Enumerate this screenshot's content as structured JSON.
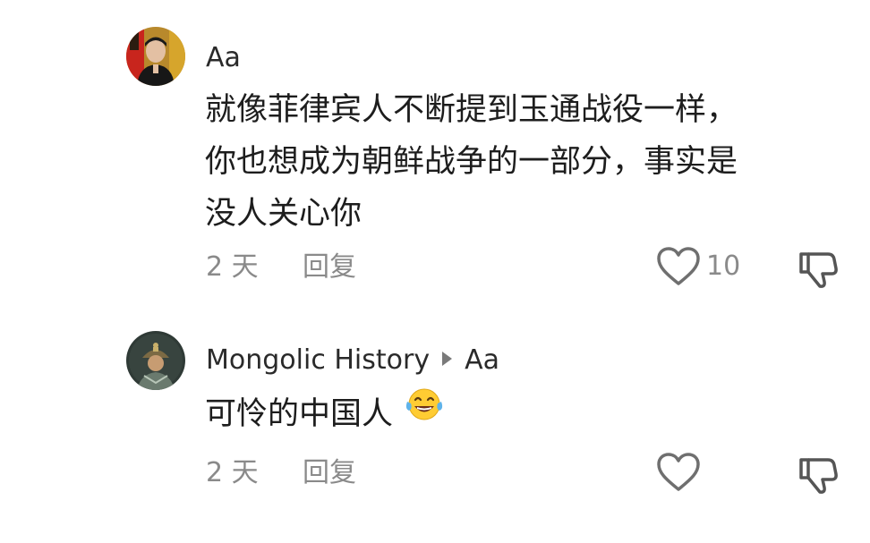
{
  "comments": [
    {
      "username": "Aa",
      "text_lines": [
        "就像菲律宾人不断提到玉通战役一样，",
        "你也想成为朝鲜战争的一部分，事实是",
        "没人关心你"
      ],
      "time": "2 天",
      "reply_label": "回复",
      "like_count": "10",
      "avatar_icon": "user-photo-avatar",
      "like_icon": "heart-outline-icon",
      "dislike_icon": "thumbs-down-icon"
    },
    {
      "username": "Mongolic History",
      "reply_to": "Aa",
      "text": "可怜的中国人",
      "emoji": "tears-of-joy-emoji",
      "time": "2 天",
      "reply_label": "回复",
      "avatar_icon": "illustrated-avatar",
      "like_icon": "heart-outline-icon",
      "dislike_icon": "thumbs-down-icon"
    }
  ],
  "colors": {
    "text": "#1d1d1d",
    "username": "#2a2a2a",
    "meta": "#8a8a8a",
    "background": "#ffffff"
  }
}
